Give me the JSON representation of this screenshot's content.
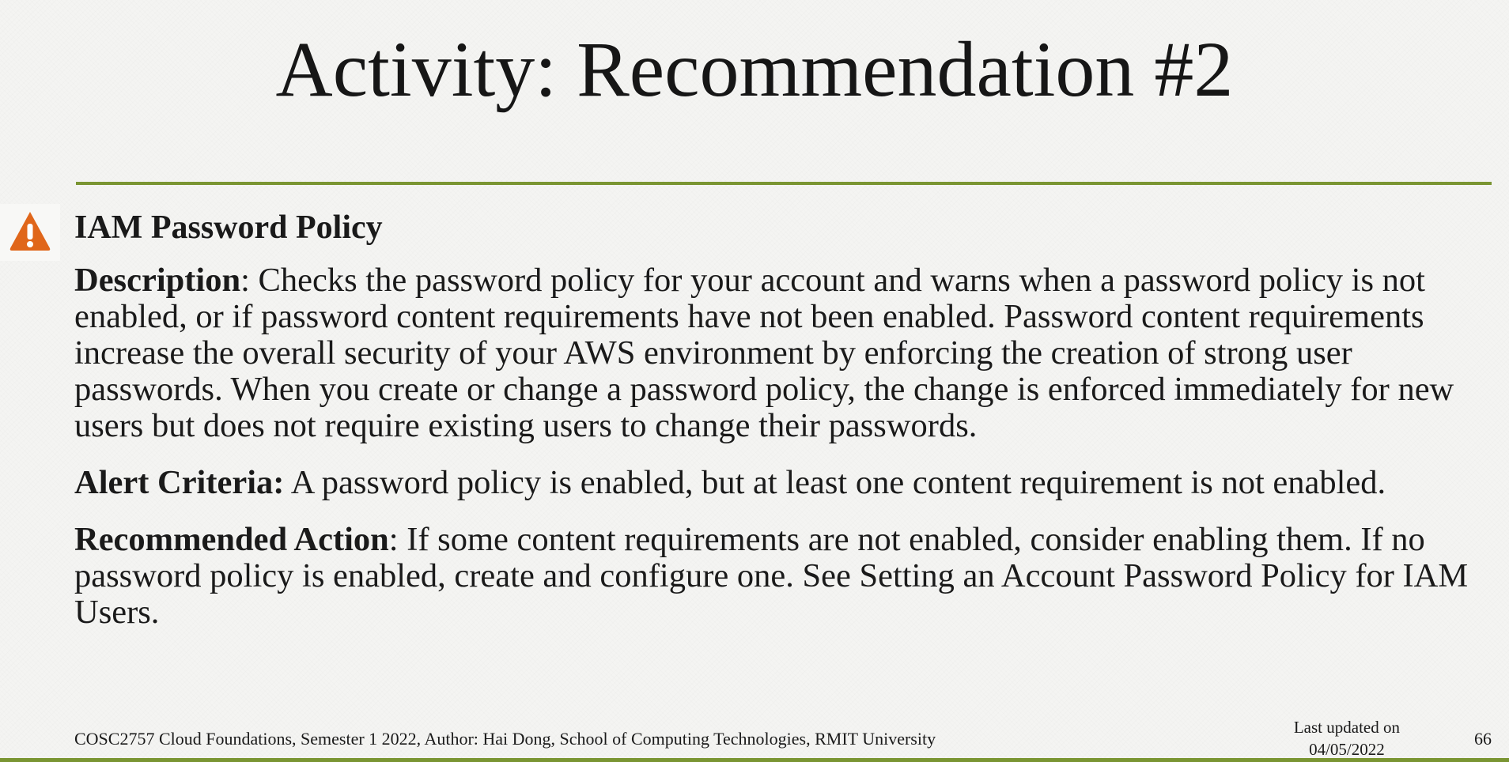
{
  "slide": {
    "title": "Activity: Recommendation #2",
    "alert_icon": "warning-triangle-icon",
    "heading": "IAM Password Policy",
    "description": {
      "label": "Description",
      "text": ": Checks the password policy for your account and warns when a password policy is not enabled, or if password content requirements have not been enabled. Password content requirements increase the overall security of your AWS environment by enforcing the creation of strong user passwords. When you create or change a password policy, the change is enforced immediately for new users but does not require existing users to change their passwords."
    },
    "alert_criteria": {
      "label": "Alert Criteria:",
      "text": " A password policy is enabled, but at least one content requirement is not enabled."
    },
    "recommended_action": {
      "label": "Recommended Action",
      "text": ": If some content requirements are not enabled, consider enabling them. If no password policy is enabled, create and configure one. See Setting an Account Password Policy for IAM Users."
    }
  },
  "footer": {
    "course_info": "COSC2757 Cloud Foundations, Semester 1 2022, Author: Hai Dong, School of Computing Technologies, RMIT University",
    "last_updated_label": "Last updated on",
    "last_updated_date": "04/05/2022",
    "page_number": "66"
  },
  "colors": {
    "accent_rule": "#7a9532",
    "warning_icon": "#e0661a"
  }
}
